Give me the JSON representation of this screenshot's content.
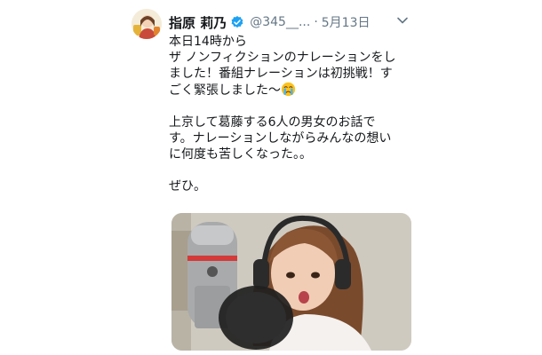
{
  "tweet": {
    "author_name": "指原 莉乃",
    "handle": "@345__...",
    "separator": "·",
    "date": "5月13日",
    "text": {
      "line1": "本日14時から",
      "line2": "ザ ノンフィクションのナレーションをし",
      "line3": "ました！番組ナレーションは初挑戦！す",
      "line4": "ごく緊張しました〜",
      "line5": "上京して葛藤する6人の男女のお話で",
      "line6": "す。ナレーションしながらみんなの想い",
      "line7": "に何度も苦しくなった。。",
      "line8": "ぜひ。"
    },
    "icons": {
      "verified": "verified-badge-icon",
      "more": "chevron-down-icon",
      "emoji": "crying-face-emoji"
    },
    "colors": {
      "verified": "#1da1f2",
      "secondary_text": "#657786"
    }
  }
}
